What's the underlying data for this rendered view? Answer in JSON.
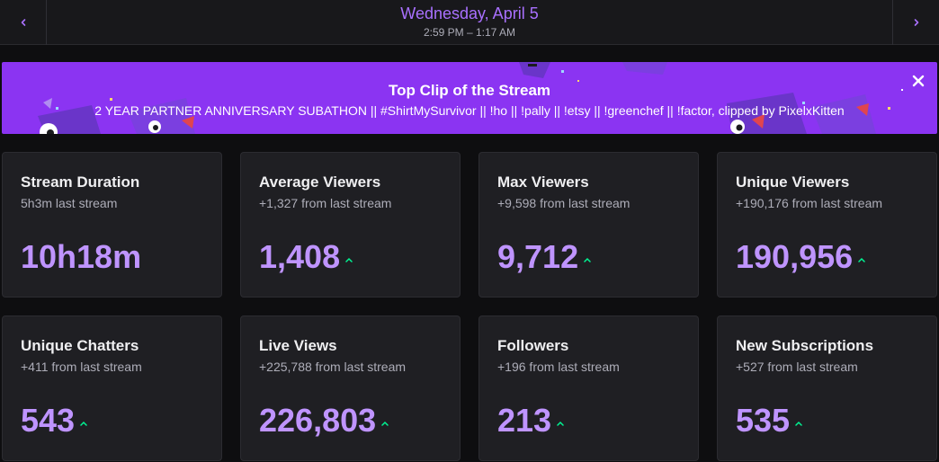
{
  "header": {
    "date": "Wednesday, April 5",
    "time_range": "2:59 PM – 1:17 AM",
    "prev_icon": "chevron-left-icon",
    "next_icon": "chevron-right-icon"
  },
  "banner": {
    "title": "Top Clip of the Stream",
    "subtitle": "2 YEAR PARTNER ANNIVERSARY SUBATHON || #ShirtMySurvivor || !ho || !pally || !etsy || !greenchef || !factor, clipped by PixelxKitten",
    "close_icon": "close-icon",
    "background_color": "#8b34f2"
  },
  "colors": {
    "accent": "#a970ff",
    "value": "#bf94ff",
    "trend_up": "#00f593"
  },
  "stats": [
    {
      "title": "Stream Duration",
      "subtitle": "5h3m last stream",
      "value": "10h18m",
      "trend": "none"
    },
    {
      "title": "Average Viewers",
      "subtitle": "+1,327 from last stream",
      "value": "1,408",
      "trend": "up"
    },
    {
      "title": "Max Viewers",
      "subtitle": "+9,598 from last stream",
      "value": "9,712",
      "trend": "up"
    },
    {
      "title": "Unique Viewers",
      "subtitle": "+190,176 from last stream",
      "value": "190,956",
      "trend": "up"
    },
    {
      "title": "Unique Chatters",
      "subtitle": "+411 from last stream",
      "value": "543",
      "trend": "up"
    },
    {
      "title": "Live Views",
      "subtitle": "+225,788 from last stream",
      "value": "226,803",
      "trend": "up"
    },
    {
      "title": "Followers",
      "subtitle": "+196 from last stream",
      "value": "213",
      "trend": "up"
    },
    {
      "title": "New Subscriptions",
      "subtitle": "+527 from last stream",
      "value": "535",
      "trend": "up"
    }
  ]
}
